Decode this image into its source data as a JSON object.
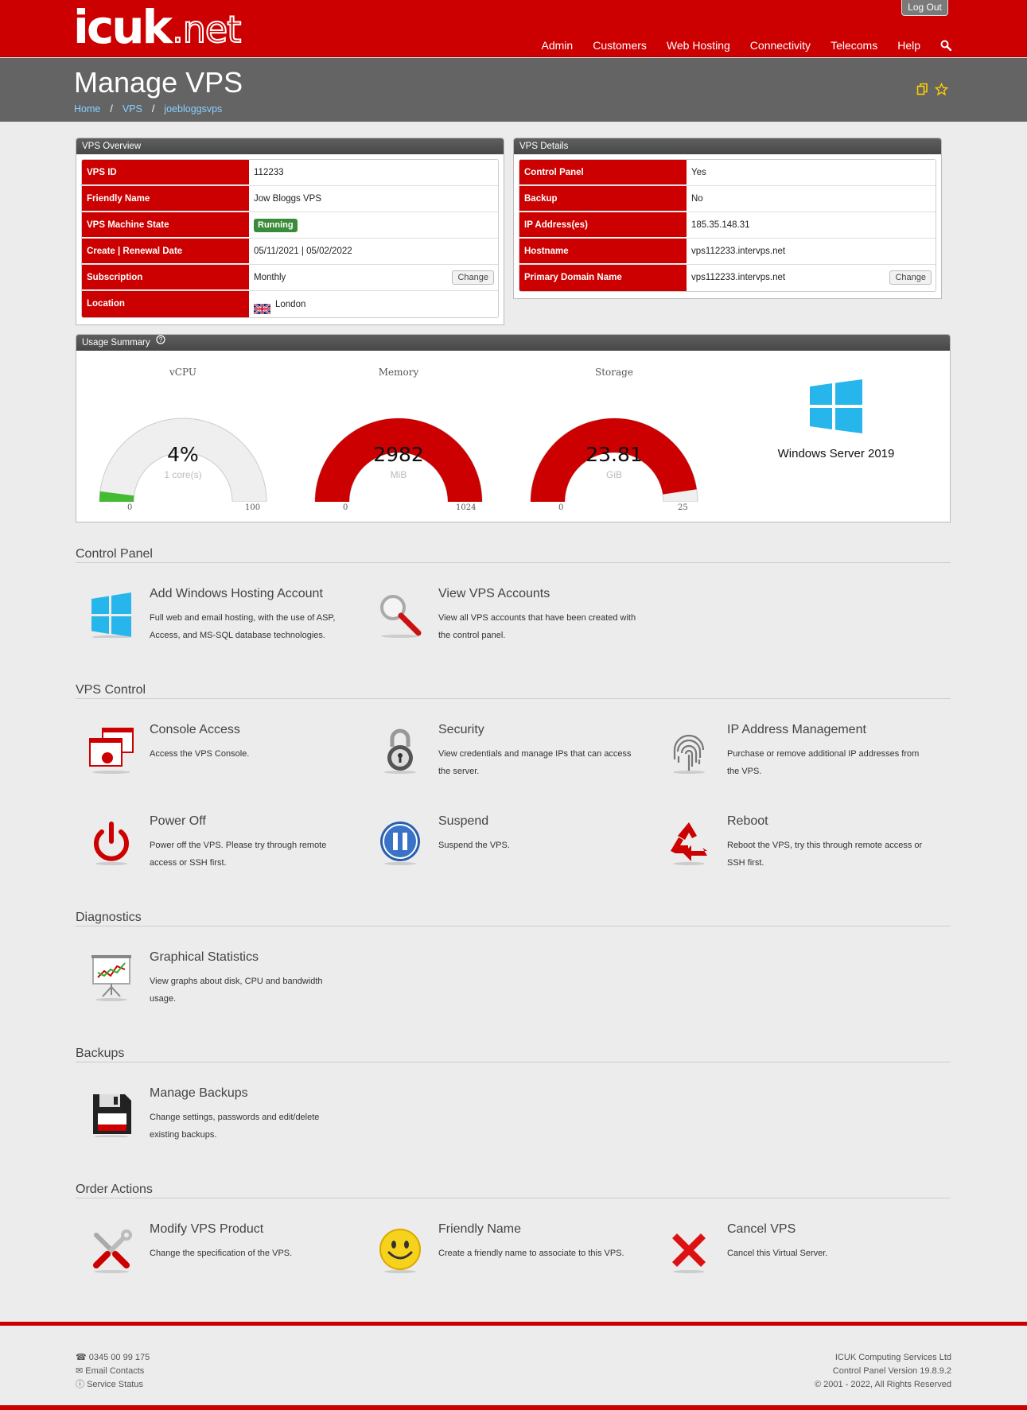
{
  "header": {
    "logo_main": "icuk",
    "logo_suffix": ".net",
    "logout_label": "Log Out",
    "nav": [
      "Admin",
      "Customers",
      "Web Hosting",
      "Connectivity",
      "Telecoms",
      "Help"
    ],
    "search_icon": "search-icon"
  },
  "page": {
    "title": "Manage VPS",
    "breadcrumb": [
      "Home",
      "VPS",
      "joebloggsvps"
    ]
  },
  "overview": {
    "title": "VPS Overview",
    "rows": [
      {
        "label": "VPS ID",
        "value": "112233"
      },
      {
        "label": "Friendly Name",
        "value": "Jow Bloggs VPS"
      },
      {
        "label": "VPS Machine State",
        "value": "Running"
      },
      {
        "label": "Create | Renewal Date",
        "value": "05/11/2021 | 05/02/2022"
      },
      {
        "label": "Subscription",
        "value": "Monthly"
      },
      {
        "label": "Location",
        "value": "London"
      }
    ],
    "change_label": "Change"
  },
  "details": {
    "title": "VPS Details",
    "rows": [
      {
        "label": "Control Panel",
        "value": "Yes"
      },
      {
        "label": "Backup",
        "value": "No"
      },
      {
        "label": "IP Address(es)",
        "value": "185.35.148.31"
      },
      {
        "label": "Hostname",
        "value": "vps112233.intervps.net"
      },
      {
        "label": "Primary Domain Name",
        "value": "vps112233.intervps.net"
      }
    ],
    "change_label": "Change"
  },
  "usage": {
    "title": "Usage Summary",
    "gauges": [
      {
        "label": "vCPU",
        "value": "4%",
        "unit": "1 core(s)",
        "min": "0",
        "max": "100",
        "fraction": 0.04
      },
      {
        "label": "Memory",
        "value": "2982",
        "unit": "MiB",
        "min": "0",
        "max": "1024",
        "fraction": 1.0
      },
      {
        "label": "Storage",
        "value": "23.81",
        "unit": "GiB",
        "min": "0",
        "max": "25",
        "fraction": 0.952
      }
    ],
    "os": "Windows Server 2019",
    "colors": {
      "red": "#cc0000",
      "green": "#44bb33",
      "track": "#efefef"
    }
  },
  "sections": [
    {
      "title": "Control Panel",
      "items": [
        {
          "title": "Add Windows Hosting Account",
          "desc": "Full web and email hosting, with the use of ASP, Access, and MS-SQL database technologies.",
          "icon": "windows-icon"
        },
        {
          "title": "View VPS Accounts",
          "desc": "View all VPS accounts that have been created with the control panel.",
          "icon": "magnifier-icon"
        }
      ]
    },
    {
      "title": "VPS Control",
      "items": [
        {
          "title": "Console Access",
          "desc": "Access the VPS Console.",
          "icon": "console-icon"
        },
        {
          "title": "Security",
          "desc": "View credentials and manage IPs that can access the server.",
          "icon": "padlock-icon"
        },
        {
          "title": "IP Address Management",
          "desc": "Purchase or remove additional IP addresses from the VPS.",
          "icon": "fingerprint-icon"
        },
        {
          "title": "Power Off",
          "desc": "Power off the VPS. Please try through remote access or SSH first.",
          "icon": "power-icon"
        },
        {
          "title": "Suspend",
          "desc": "Suspend the VPS.",
          "icon": "pause-icon"
        },
        {
          "title": "Reboot",
          "desc": "Reboot the VPS, try this through remote access or SSH first.",
          "icon": "recycle-icon"
        }
      ]
    },
    {
      "title": "Diagnostics",
      "items": [
        {
          "title": "Graphical Statistics",
          "desc": "View graphs about disk, CPU and bandwidth usage.",
          "icon": "chart-board-icon"
        }
      ]
    },
    {
      "title": "Backups",
      "items": [
        {
          "title": "Manage Backups",
          "desc": "Change settings, passwords and edit/delete existing backups.",
          "icon": "floppy-disk-icon"
        }
      ]
    },
    {
      "title": "Order Actions",
      "items": [
        {
          "title": "Modify VPS Product",
          "desc": "Change the specification of the VPS.",
          "icon": "tools-icon"
        },
        {
          "title": "Friendly Name",
          "desc": "Create a friendly name to associate to this VPS.",
          "icon": "smiley-icon"
        },
        {
          "title": "Cancel VPS",
          "desc": "Cancel this Virtual Server.",
          "icon": "cross-icon"
        }
      ]
    }
  ],
  "footer": {
    "phone": "0345 00 99 175",
    "email": "Email Contacts",
    "status": "Service Status",
    "company": "ICUK Computing Services Ltd",
    "version": "Control Panel Version 19.8.9.2",
    "copyright": "© 2001 - 2022, All Rights Reserved"
  }
}
